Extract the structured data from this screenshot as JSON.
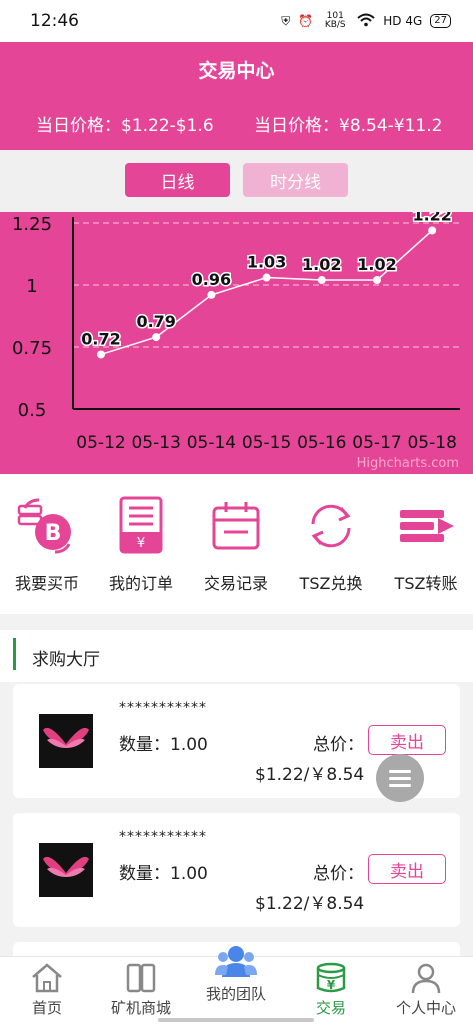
{
  "status_bar": {
    "time": "12:46",
    "net_speed": "101 KB/S",
    "network": "HD 4G",
    "battery": "27"
  },
  "header": {
    "title": "交易中心",
    "price_left": "当日价格：$1.22-$1.6",
    "price_right": "当日价格：¥8.54-¥11.2"
  },
  "toggle": {
    "day_label": "日线",
    "hour_label": "时分线"
  },
  "chart_data": {
    "type": "line",
    "categories": [
      "05-12",
      "05-13",
      "05-14",
      "05-15",
      "05-16",
      "05-17",
      "05-18"
    ],
    "values": [
      0.72,
      0.79,
      0.96,
      1.03,
      1.02,
      1.02,
      1.22
    ],
    "data_labels": [
      "0.72",
      "0.79",
      "0.96",
      "1.03",
      "1.02",
      "1.02",
      "1.22"
    ],
    "y_ticks": [
      "1.25",
      "1",
      "0.75",
      "0.5"
    ],
    "ylim": [
      0.5,
      1.25
    ],
    "grid": true,
    "credit": "Highcharts.com",
    "line_color": "#ffffff",
    "background": "#e44597"
  },
  "actions": [
    {
      "label": "我要买币",
      "icon": "bitcoin-exchange-icon"
    },
    {
      "label": "我的订单",
      "icon": "order-receipt-icon"
    },
    {
      "label": "交易记录",
      "icon": "calendar-record-icon"
    },
    {
      "label": "TSZ兑换",
      "icon": "refresh-exchange-icon"
    },
    {
      "label": "TSZ转账",
      "icon": "transfer-icon"
    }
  ],
  "section": {
    "title": "求购大厅"
  },
  "orders": [
    {
      "user": "***********",
      "quantity": "数量：1.00",
      "total_label": "总价：",
      "price": "$1.22/￥8.54",
      "sell_label": "卖出"
    },
    {
      "user": "***********",
      "quantity": "数量：1.00",
      "total_label": "总价：",
      "price": "$1.22/￥8.54",
      "sell_label": "卖出"
    }
  ],
  "tabbar": [
    {
      "label": "首页",
      "icon": "home-icon"
    },
    {
      "label": "矿机商城",
      "icon": "miner-shop-icon"
    },
    {
      "label": "我的团队",
      "icon": "team-icon"
    },
    {
      "label": "交易",
      "icon": "trade-coin-icon",
      "active": true
    },
    {
      "label": "个人中心",
      "icon": "person-icon"
    }
  ],
  "colors": {
    "accent": "#e44597",
    "light_accent": "#f1b1d2",
    "active_tab": "#2a9a45"
  }
}
